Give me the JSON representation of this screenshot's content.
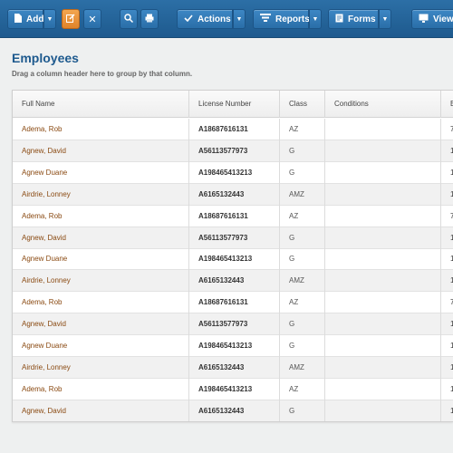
{
  "toolbar": {
    "add_label": "Add",
    "actions_label": "Actions",
    "reports_label": "Reports",
    "forms_label": "Forms",
    "view_label": "View"
  },
  "page": {
    "title": "Employees",
    "hint": "Drag a column header here to group by that column."
  },
  "grid": {
    "columns": [
      "Full Name",
      "License Number",
      "Class",
      "Conditions",
      "E"
    ],
    "rows": [
      {
        "name": "Adema, Rob",
        "license": "A18687616131",
        "class": "AZ",
        "conditions": "",
        "extra": "7"
      },
      {
        "name": "Agnew, David",
        "license": "A56113577973",
        "class": "G",
        "conditions": "",
        "extra": "1"
      },
      {
        "name": "Agnew Duane",
        "license": "A198465413213",
        "class": "G",
        "conditions": "",
        "extra": "1"
      },
      {
        "name": "Airdrie, Lonney",
        "license": "A6165132443",
        "class": "AMZ",
        "conditions": "",
        "extra": "1"
      },
      {
        "name": "Adema, Rob",
        "license": "A18687616131",
        "class": "AZ",
        "conditions": "",
        "extra": "7"
      },
      {
        "name": "Agnew, David",
        "license": "A56113577973",
        "class": "G",
        "conditions": "",
        "extra": "1"
      },
      {
        "name": "Agnew Duane",
        "license": "A198465413213",
        "class": "G",
        "conditions": "",
        "extra": "1"
      },
      {
        "name": "Airdrie, Lonney",
        "license": "A6165132443",
        "class": "AMZ",
        "conditions": "",
        "extra": "1"
      },
      {
        "name": "Adema, Rob",
        "license": "A18687616131",
        "class": "AZ",
        "conditions": "",
        "extra": "7"
      },
      {
        "name": "Agnew, David",
        "license": "A56113577973",
        "class": "G",
        "conditions": "",
        "extra": "1"
      },
      {
        "name": "Agnew Duane",
        "license": "A198465413213",
        "class": "G",
        "conditions": "",
        "extra": "1"
      },
      {
        "name": "Airdrie, Lonney",
        "license": "A6165132443",
        "class": "AMZ",
        "conditions": "",
        "extra": "1"
      },
      {
        "name": "Adema, Rob",
        "license": "A198465413213",
        "class": "AZ",
        "conditions": "",
        "extra": "1"
      },
      {
        "name": "Agnew, David",
        "license": "A6165132443",
        "class": "G",
        "conditions": "",
        "extra": "1"
      }
    ]
  },
  "colors": {
    "toolbar": "#1e5a8e",
    "title": "#1e5a8e",
    "name_link": "#8a4a12",
    "edit_button": "#e0832a"
  },
  "icons": {
    "add": "document-icon",
    "edit": "edit-icon",
    "delete": "close-icon",
    "search": "search-icon",
    "print": "print-icon",
    "actions": "checkmark-icon",
    "reports": "reports-icon",
    "forms": "forms-icon",
    "view": "monitor-icon"
  }
}
